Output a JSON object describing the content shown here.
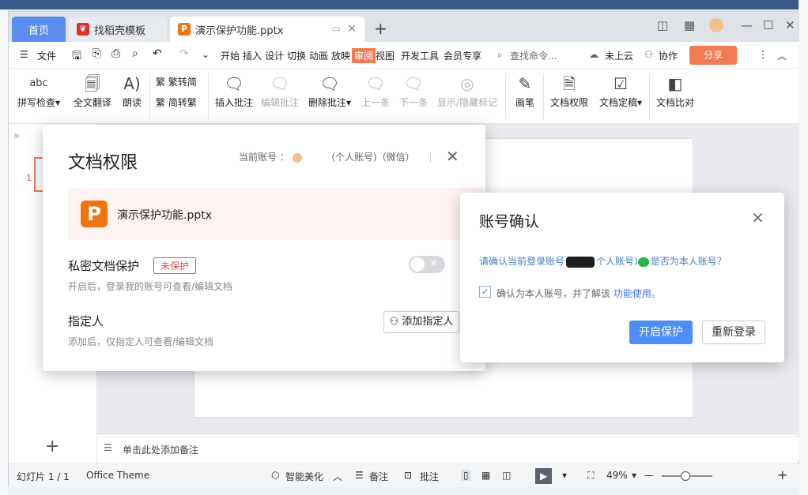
{
  "tabs": {
    "home": "首页",
    "template": "找稻壳模板",
    "document": "演示保护功能.pptx"
  },
  "menu": {
    "file": "文件",
    "items": [
      "开始",
      "插入",
      "设计",
      "切换",
      "动画",
      "放映",
      "审阅",
      "视图",
      "开发工具",
      "会员专享"
    ],
    "active": "审阅",
    "search_placeholder": "查找命令...",
    "cloud": "未上云",
    "collab": "协作",
    "share": "分享"
  },
  "ribbon": {
    "spellcheck": "拼写检查",
    "translate": "全文翻译",
    "read": "朗读",
    "trad": "繁转简",
    "simp": "简转繁",
    "insert_comment": "插入批注",
    "edit_comment": "编辑批注",
    "delete_comment": "删除批注",
    "prev": "上一条",
    "next": "下一条",
    "show_hide": "显示/隐藏标记",
    "pen": "画笔",
    "doc_permission": "文档权限",
    "doc_finalize": "文档定稿",
    "doc_compare": "文档比对"
  },
  "workspace": {
    "slide_number": "1",
    "notes_placeholder": "单击此处添加备注"
  },
  "statusbar": {
    "slide_info": "幻灯片 1 / 1",
    "theme": "Office Theme",
    "beautify": "智能美化",
    "notes": "备注",
    "comments": "批注",
    "zoom": "49%"
  },
  "permission_dialog": {
    "title": "文档权限",
    "account_label": "当前账号 ：",
    "account_type": "(个人账号)（微信）",
    "filename": "演示保护功能.pptx",
    "private_title": "私密文档保护",
    "private_badge": "未保护",
    "private_desc": "开启后，登录我的账号可查看/编辑文档",
    "designee_title": "指定人",
    "designee_desc": "添加后，仅指定人可查看/编辑文档",
    "add_designee": "添加指定人"
  },
  "confirm_dialog": {
    "title": "账号确认",
    "question_prefix": "请确认当前登录账号",
    "question_mid": "个人账号)",
    "question_suffix": "是否为本人账号？",
    "checkbox_text": "确认为本人账号，并了解该",
    "checkbox_link": "功能使用。",
    "enable_button": "开启保护",
    "relogin_button": "重新登录"
  }
}
